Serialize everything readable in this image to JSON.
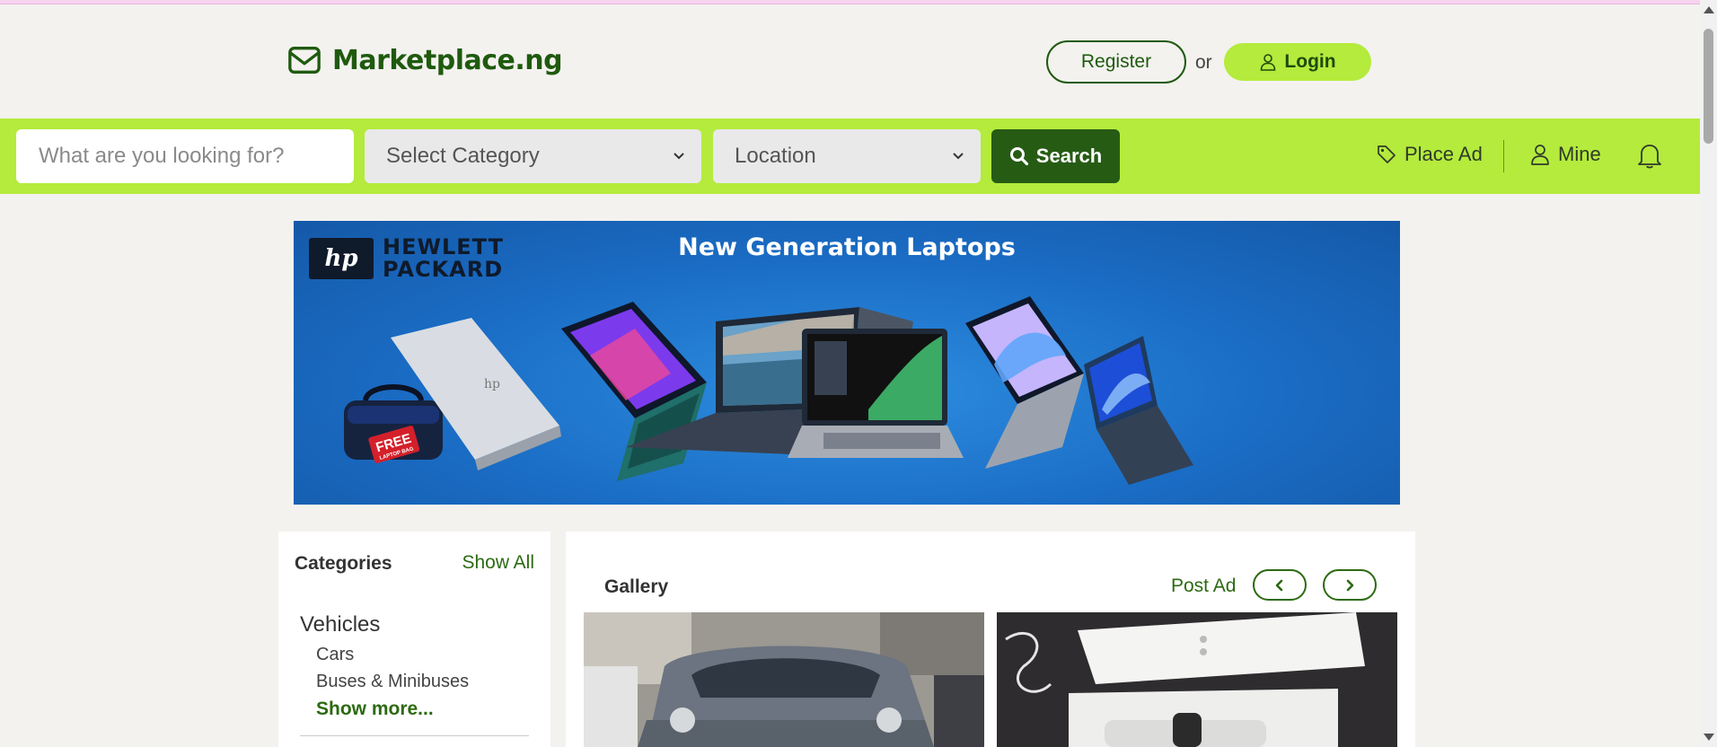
{
  "brand": {
    "name": "Marketplace.ng",
    "accent": "#b4eb3c",
    "dark_green": "#265b14"
  },
  "header": {
    "register_label": "Register",
    "or_label": "or",
    "login_label": "Login"
  },
  "searchbar": {
    "placeholder": "What are you looking for?",
    "category_label": "Select Category",
    "location_label": "Location",
    "search_label": "Search",
    "place_ad_label": "Place Ad",
    "mine_label": "Mine"
  },
  "banner": {
    "brand_mark": "hp",
    "brand_line1": "HEWLETT",
    "brand_line2": "PACKARD",
    "title": "New Generation Laptops",
    "badge_line1": "FREE",
    "badge_line2": "LAPTOP BAG"
  },
  "categories": {
    "title": "Categories",
    "show_all_label": "Show All",
    "groups": [
      {
        "title": "Vehicles",
        "items": [
          "Cars",
          "Buses & Minibuses"
        ],
        "show_more_label": "Show more..."
      }
    ]
  },
  "gallery": {
    "title": "Gallery",
    "post_ad_label": "Post Ad"
  },
  "icons": {
    "logo": "envelope-logo-icon",
    "login": "user-icon",
    "search": "search-icon",
    "place_ad": "tag-icon",
    "mine": "user-icon",
    "notifications": "bell-icon",
    "prev": "chevron-left-icon",
    "next": "chevron-right-icon"
  }
}
